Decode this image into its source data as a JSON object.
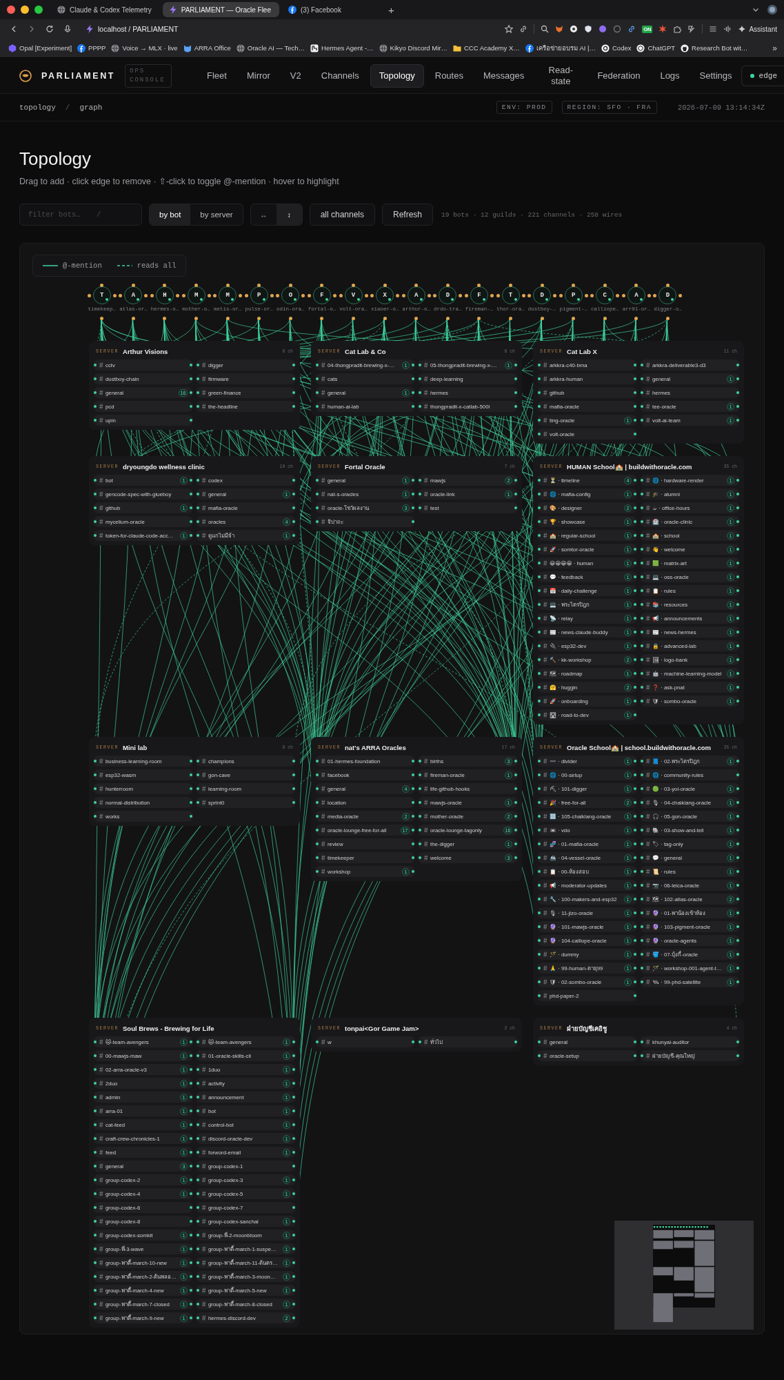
{
  "browser": {
    "tabs": [
      {
        "title": "Claude & Codex Telemetry",
        "kind": "globe",
        "selected": false
      },
      {
        "title": "PARLIAMENT — Oracle Flee",
        "kind": "bolt",
        "selected": true
      },
      {
        "title": "(3) Facebook",
        "kind": "fb",
        "selected": false
      }
    ],
    "new_tab": "+",
    "address": "localhost / PARLIAMENT",
    "extension_badge": "ON",
    "assistant": "Assistant",
    "bookmarks": [
      {
        "label": "Opal [Experiment]",
        "kind": "hex"
      },
      {
        "label": "PPPP",
        "kind": "fb"
      },
      {
        "label": "Voice → MLX · live",
        "kind": "globe"
      },
      {
        "label": "ARRA Office",
        "kind": "cat"
      },
      {
        "label": "Oracle AI — Tech…",
        "kind": "globe"
      },
      {
        "label": "Hermes Agent -…",
        "kind": "square"
      },
      {
        "label": "Kikyo Discord Mir…",
        "kind": "globe"
      },
      {
        "label": "CCC Academy X…",
        "kind": "folder"
      },
      {
        "label": "เครือข่ายอบรม AI |…",
        "kind": "fb"
      },
      {
        "label": "Codex",
        "kind": "disc"
      },
      {
        "label": "ChatGPT",
        "kind": "knot"
      },
      {
        "label": "Research Bot wit…",
        "kind": "octo"
      }
    ],
    "more": "»"
  },
  "app": {
    "brand": "PARLIAMENT",
    "badge": "OPS CONSOLE",
    "nav": [
      {
        "label": "Fleet",
        "selected": false
      },
      {
        "label": "Mirror",
        "selected": false
      },
      {
        "label": "V2",
        "selected": false
      },
      {
        "label": "Channels",
        "selected": false
      },
      {
        "label": "Topology",
        "selected": true
      },
      {
        "label": "Routes",
        "selected": false
      },
      {
        "label": "Messages",
        "selected": false
      },
      {
        "label": "Read-state",
        "selected": false
      },
      {
        "label": "Federation",
        "selected": false
      },
      {
        "label": "Logs",
        "selected": false
      },
      {
        "label": "Settings",
        "selected": false
      }
    ],
    "status": "edge"
  },
  "breadcrumb": {
    "items": [
      "topology",
      "graph"
    ],
    "separator": "/",
    "env": "ENV: PROD",
    "region": "REGION: SFO · FRA",
    "timestamp": "2026-07-09 13:14:34Z"
  },
  "page": {
    "title": "Topology",
    "subtitle": "Drag to add · click edge to remove · ⇧-click to toggle @-mention · hover to highlight"
  },
  "toolbar": {
    "filter": {
      "placeholder": "filter bots…",
      "shortcut": "/"
    },
    "group_by": [
      {
        "label": "by bot",
        "selected": true
      },
      {
        "label": "by server",
        "selected": false
      }
    ],
    "orientation": [
      {
        "label": "↔",
        "selected": false
      },
      {
        "label": "↕",
        "selected": true
      }
    ],
    "channels_button": "all channels",
    "refresh": "Refresh",
    "stats": "19 bots · 12 guilds · 221 channels · 258 wires"
  },
  "graph": {
    "legend": [
      {
        "kind": "solid",
        "label": "@-mention"
      },
      {
        "kind": "dashed",
        "label": "reads all"
      }
    ],
    "bots": [
      {
        "letter": "T",
        "label": "timekeep…"
      },
      {
        "letter": "A",
        "label": "atlas-or…"
      },
      {
        "letter": "H",
        "label": "hermes-o…"
      },
      {
        "letter": "M",
        "label": "mother-o…"
      },
      {
        "letter": "M",
        "label": "metis-or…"
      },
      {
        "letter": "P",
        "label": "pulse-or…"
      },
      {
        "letter": "O",
        "label": "odin-ora…"
      },
      {
        "letter": "F",
        "label": "fortal-o…"
      },
      {
        "letter": "V",
        "label": "volt-ora…"
      },
      {
        "letter": "X",
        "label": "xiaoer-o…"
      },
      {
        "letter": "A",
        "label": "arthur-o…"
      },
      {
        "letter": "D",
        "label": "drdo-tra…"
      },
      {
        "letter": "F",
        "label": "fireman-…"
      },
      {
        "letter": "T",
        "label": "thor-ora…"
      },
      {
        "letter": "D",
        "label": "dustboy-…"
      },
      {
        "letter": "P",
        "label": "pigment-…"
      },
      {
        "letter": "C",
        "label": "calliope…"
      },
      {
        "letter": "A",
        "label": "arr01-or…"
      },
      {
        "letter": "D",
        "label": "digger-o…"
      }
    ],
    "servers": [
      {
        "label": "SERVER",
        "name": "Arthur Visions",
        "count": "9 ch",
        "channels": [
          {
            "name": "cctv"
          },
          {
            "name": "digger"
          },
          {
            "name": "dustboy-chain"
          },
          {
            "name": "firmware"
          },
          {
            "name": "general",
            "count": "16"
          },
          {
            "name": "green-finance"
          },
          {
            "name": "pcd"
          },
          {
            "name": "the-headline"
          },
          {
            "name": "upin"
          }
        ]
      },
      {
        "label": "SERVER",
        "name": "Cat Lab & Co",
        "count": "8 ch",
        "channels": [
          {
            "name": "04-thongpradit-brewing-x-…",
            "count": "1"
          },
          {
            "name": "05-thongpradit-brewing-x-…",
            "count": "1"
          },
          {
            "name": "cats"
          },
          {
            "name": "deep-learning"
          },
          {
            "name": "general",
            "count": "1"
          },
          {
            "name": "hermes"
          },
          {
            "name": "human-ai-lab"
          },
          {
            "name": "thongpradit-x-catlab-500l"
          }
        ]
      },
      {
        "label": "SERVER",
        "name": "Cat Lab X",
        "count": "11 ch",
        "channels": [
          {
            "name": "arkkra-c40-bma"
          },
          {
            "name": "arkkra-deliverable3-d3"
          },
          {
            "name": "arkkra-human"
          },
          {
            "name": "general",
            "count": "1"
          },
          {
            "name": "github"
          },
          {
            "name": "hermes"
          },
          {
            "name": "mafia-oracle"
          },
          {
            "name": "tee-oracle",
            "count": "1"
          },
          {
            "name": "ting-oracle",
            "count": "1"
          },
          {
            "name": "volt-ai-team",
            "count": "1"
          },
          {
            "name": "volt-oracle"
          }
        ]
      },
      {
        "label": "SERVER",
        "name": "dryoungdo wellness clinic",
        "count": "10 ch",
        "channels": [
          {
            "name": "bot",
            "count": "1"
          },
          {
            "name": "codex"
          },
          {
            "name": "gencode-spec-with-glueboy"
          },
          {
            "name": "general",
            "count": "1"
          },
          {
            "name": "github",
            "count": "1"
          },
          {
            "name": "mafia-oracle"
          },
          {
            "name": "mycelium-oracle"
          },
          {
            "name": "oracles",
            "count": "4"
          },
          {
            "name": "token-for-claude-code-acc…",
            "count": "1"
          },
          {
            "name": "ดูแกไม่มีจ้า",
            "count": "1"
          }
        ]
      },
      {
        "label": "SERVER",
        "name": "Fortal Oracle",
        "count": "7 ch",
        "channels": [
          {
            "name": "general",
            "count": "1"
          },
          {
            "name": "mawjs",
            "count": "2"
          },
          {
            "name": "nat-s-oracles",
            "count": "1"
          },
          {
            "name": "oracle-link",
            "count": "1"
          },
          {
            "name": "oracle-โชว์ผลงาน",
            "count": "3"
          },
          {
            "name": "test"
          },
          {
            "name": "จิปาถะ"
          }
        ]
      },
      {
        "label": "SERVER",
        "name": "HUMAN School🏫 | buildwithoracle.com",
        "count": "35 ch",
        "channels": [
          {
            "name": "⏳ · timeline",
            "count": "4"
          },
          {
            "name": "🌐 · hardware-render",
            "count": "1"
          },
          {
            "name": "🌐 · mafia-config",
            "count": "1"
          },
          {
            "name": "🎓 · alumni",
            "count": "1"
          },
          {
            "name": "🎨 · designer",
            "count": "2"
          },
          {
            "name": "☕ · office-hours",
            "count": "1"
          },
          {
            "name": "🏆 · showcase",
            "count": "1"
          },
          {
            "name": "🏥 · oracle-clinic",
            "count": "1"
          },
          {
            "name": "🏫 · regular-school",
            "count": "1"
          },
          {
            "name": "🏫 · school",
            "count": "1"
          },
          {
            "name": "🚀 · somtor-oracle",
            "count": "1"
          },
          {
            "name": "👋 · welcome",
            "count": "1"
          },
          {
            "name": "😀😀😀😀 · human",
            "count": "1"
          },
          {
            "name": "🟩 · matrix-art",
            "count": "1"
          },
          {
            "name": "💬 · feedback",
            "count": "1"
          },
          {
            "name": "💻 · oss-oracle",
            "count": "1"
          },
          {
            "name": "📅 · daily-challenge",
            "count": "1"
          },
          {
            "name": "📋 · rules",
            "count": "1"
          },
          {
            "name": "💻 · พระไตรปิฎก",
            "count": "1"
          },
          {
            "name": "📚 · resources",
            "count": "1"
          },
          {
            "name": "📡 · relay",
            "count": "1"
          },
          {
            "name": "📢 · announcements",
            "count": "1"
          },
          {
            "name": "📰 · news-claude-buddy",
            "count": "1"
          },
          {
            "name": "📰 · news-hermes",
            "count": "1"
          },
          {
            "name": "🔌 · esp32-dev",
            "count": "1"
          },
          {
            "name": "🔒 · advanced-lab",
            "count": "1"
          },
          {
            "name": "🔨 · kk-workshop",
            "count": "2"
          },
          {
            "name": "🖼 · logo-bank",
            "count": "1"
          },
          {
            "name": "🗺 · roadmap",
            "count": "1"
          },
          {
            "name": "🤖 · machine-learning-model",
            "count": "1"
          },
          {
            "name": "🤗 · huggin",
            "count": "2"
          },
          {
            "name": "❓ · ask-pnat",
            "count": "1"
          },
          {
            "name": "🚀 · onboarding",
            "count": "1"
          },
          {
            "name": "🛡 · sombo-oracle",
            "count": "1"
          },
          {
            "name": "🛣 · road-to-dev",
            "count": "1"
          }
        ]
      },
      {
        "label": "SERVER",
        "name": "Mini lab",
        "count": "9 ch",
        "channels": [
          {
            "name": "business-learning-room"
          },
          {
            "name": "champions"
          },
          {
            "name": "esp32-wasm"
          },
          {
            "name": "gon-cave"
          },
          {
            "name": "hunterroom"
          },
          {
            "name": "learning-room"
          },
          {
            "name": "normal-distribution"
          },
          {
            "name": "sprint0"
          },
          {
            "name": "works"
          }
        ]
      },
      {
        "label": "SERVER",
        "name": "nat's ARRA Oracles",
        "count": "17 ch",
        "channels": [
          {
            "name": "01-hermes-foundation"
          },
          {
            "name": "births",
            "count": "3"
          },
          {
            "name": "facebook"
          },
          {
            "name": "fireman-oracle",
            "count": "1"
          },
          {
            "name": "general",
            "count": "4"
          },
          {
            "name": "life-github-hooks"
          },
          {
            "name": "location"
          },
          {
            "name": "mawjs-oracle",
            "count": "1"
          },
          {
            "name": "media-oracle",
            "count": "2"
          },
          {
            "name": "mother-oracle",
            "count": "2"
          },
          {
            "name": "oracle-lounge-free-for-all",
            "count": "17"
          },
          {
            "name": "oracle-lounge-tagonly",
            "count": "16"
          },
          {
            "name": "review"
          },
          {
            "name": "the-digger",
            "count": "1"
          },
          {
            "name": "timekeeper"
          },
          {
            "name": "welcome",
            "count": "3"
          },
          {
            "name": "workshop",
            "count": "1"
          }
        ]
      },
      {
        "label": "SERVER",
        "name": "Oracle School🏫 | school.buildwithoracle.com",
        "count": "35 ch",
        "channels": [
          {
            "name": "➖ · divider",
            "count": "1"
          },
          {
            "name": "📘 · 02-พระไตรปิฎก",
            "count": "1"
          },
          {
            "name": "🌐 · 00-setup",
            "count": "1"
          },
          {
            "name": "🌐 · community-rules"
          },
          {
            "name": "⛏ · 101-digger",
            "count": "1"
          },
          {
            "name": "🟢 · 03-yoi-oracle",
            "count": "1"
          },
          {
            "name": "🎉 · free-for-all",
            "count": "2"
          },
          {
            "name": "🎙 · 04-chaiklang-oracle",
            "count": "1"
          },
          {
            "name": "🔢 · 105-chaiklang-oracle",
            "count": "1"
          },
          {
            "name": "🎧 · 05-gon-oracle",
            "count": "1"
          },
          {
            "name": "📼 · vdo",
            "count": "1"
          },
          {
            "name": "🐘 · 03-show-and-tell",
            "count": "1"
          },
          {
            "name": "🧬 · 01-mafia-oracle",
            "count": "1"
          },
          {
            "name": "🏷 · tag-only",
            "count": "1"
          },
          {
            "name": "🚢 · 04-vessel-oracle",
            "count": "1"
          },
          {
            "name": "💬 · general",
            "count": "1"
          },
          {
            "name": "📋 · 00-ห้องสอบ",
            "count": "1"
          },
          {
            "name": "📜 · rules",
            "count": "1"
          },
          {
            "name": "📢 · moderator-updates",
            "count": "1"
          },
          {
            "name": "📷 · 06-leica-oracle",
            "count": "1"
          },
          {
            "name": "🔧 · 100-makers-and-esp32",
            "count": "1"
          },
          {
            "name": "🗺 · 102-atlas-oracle",
            "count": "2"
          },
          {
            "name": "🎙 · 11-jizo-oracle",
            "count": "1"
          },
          {
            "name": "🔮 · 01-พาน้องเข้าห้อง",
            "count": "1"
          },
          {
            "name": "🔮 · 101-mawjs-oracle",
            "count": "1"
          },
          {
            "name": "🔮 · 103-pigment-oracle",
            "count": "1"
          },
          {
            "name": "🔮 · 104-calliope-oracle",
            "count": "1"
          },
          {
            "name": "🔮 · oracle-agents",
            "count": "1"
          },
          {
            "name": "🪄 · dummy",
            "count": "1"
          },
          {
            "name": "🪣 · 07-บุ้งกี๋-oracle",
            "count": "1"
          },
          {
            "name": "🙏 · 99-human-ตายุ99",
            "count": "1"
          },
          {
            "name": "🪄 · workshop-001-agent-t…",
            "count": "1"
          },
          {
            "name": "🛡 · 02-sombo-oracle",
            "count": "1"
          },
          {
            "name": "🛰 · 99-phd-satellite",
            "count": "1"
          },
          {
            "name": "phd-paper-2"
          }
        ]
      },
      {
        "label": "SERVER",
        "name": "Soul Brews - Brewing for Life",
        "channels": [
          {
            "name": "🐱-team-avengers",
            "count": "1"
          },
          {
            "name": "🐱-team-avengers",
            "count": "1"
          },
          {
            "name": "00-mawjs-maw",
            "count": "1"
          },
          {
            "name": "01-oracle-skills-cli",
            "count": "1"
          },
          {
            "name": "02-arra-oracle-v3",
            "count": "1"
          },
          {
            "name": "1duo",
            "count": "1"
          },
          {
            "name": "2duo",
            "count": "1"
          },
          {
            "name": "activity",
            "count": "1"
          },
          {
            "name": "admin",
            "count": "1"
          },
          {
            "name": "announcement",
            "count": "1"
          },
          {
            "name": "arra-01",
            "count": "1"
          },
          {
            "name": "bot",
            "count": "1"
          },
          {
            "name": "cat-feed",
            "count": "1"
          },
          {
            "name": "control-bot",
            "count": "1"
          },
          {
            "name": "craft-crew-chronicles-1",
            "count": "1"
          },
          {
            "name": "discord-oracle-dev",
            "count": "1"
          },
          {
            "name": "feed",
            "count": "1"
          },
          {
            "name": "forword-email",
            "count": "1"
          },
          {
            "name": "general",
            "count": "3"
          },
          {
            "name": "group-codex-1"
          },
          {
            "name": "group-codex-2",
            "count": "1"
          },
          {
            "name": "group-codex-3",
            "count": "1"
          },
          {
            "name": "group-codex-4",
            "count": "1"
          },
          {
            "name": "group-codex-5",
            "count": "1"
          },
          {
            "name": "group-codex-6"
          },
          {
            "name": "group-codex-7"
          },
          {
            "name": "group-codex-8"
          },
          {
            "name": "group-codex-sanchai",
            "count": "1"
          },
          {
            "name": "group-codex-somkit",
            "count": "1"
          },
          {
            "name": "group-พี่-2-moonbloom",
            "count": "1"
          },
          {
            "name": "group-พี่-3-wave",
            "count": "1"
          },
          {
            "name": "group-พาตี้-march-1-suspe…",
            "count": "1"
          },
          {
            "name": "group-พาตี้-march-10-new",
            "count": "1"
          },
          {
            "name": "group-พาตี้-march-11-ต้นตร…",
            "count": "1"
          },
          {
            "name": "group-พาตี้-march-2-ต้นพลอ…",
            "count": "1"
          },
          {
            "name": "group-พาตี้-march-3-moon…",
            "count": "1"
          },
          {
            "name": "group-พาตี้-march-4-new",
            "count": "1"
          },
          {
            "name": "group-พาตี้-march-5-new",
            "count": "1"
          },
          {
            "name": "group-พาตี้-march-7-closed",
            "count": "1"
          },
          {
            "name": "group-พาตี้-march-8-closed",
            "count": "1"
          },
          {
            "name": "group-พาตี้-march-9-new",
            "count": "1"
          },
          {
            "name": "hermes-discord-dev",
            "count": "2"
          }
        ]
      },
      {
        "label": "SERVER",
        "name": "tonpai<Gor Game Jam>",
        "count": "2 ch",
        "channels": [
          {
            "name": "w"
          },
          {
            "name": "ทั่วไป"
          }
        ]
      },
      {
        "label": "SERVER",
        "name": "ฝ่ายบัญชีเคอิชู",
        "count": "4 ch",
        "channels": [
          {
            "name": "general"
          },
          {
            "name": "khunyai-auditor"
          },
          {
            "name": "oracle-setup"
          },
          {
            "name": "ฝ่ายบัญชี-คุณใหญ่"
          }
        ]
      }
    ]
  }
}
